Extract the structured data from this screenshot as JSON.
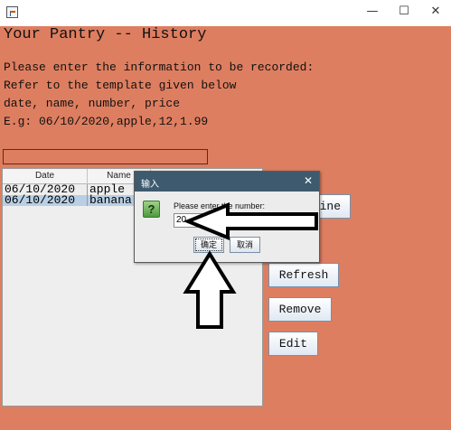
{
  "window": {
    "controls": {
      "minimize": "—",
      "maximize": "☐",
      "close": "✕"
    }
  },
  "main": {
    "heading": "Your Pantry -- History",
    "instructions": [
      "Please enter the information to be recorded:",
      "Refer to the template given below",
      "date, name, number, price",
      "E.g: 06/10/2020,apple,12,1.99"
    ],
    "input_value": ""
  },
  "table": {
    "columns": [
      "Date",
      "Name"
    ],
    "rows": [
      {
        "date": "06/10/2020",
        "name": "apple",
        "selected": false
      },
      {
        "date": "06/10/2020",
        "name": "banana",
        "selected": true
      }
    ]
  },
  "buttons": {
    "determine_partial": "ine",
    "refresh": "Refresh",
    "remove": "Remove",
    "edit": "Edit"
  },
  "dialog": {
    "title": "输入",
    "close": "✕",
    "icon": "?",
    "label": "Please enter the number:",
    "value": "20",
    "ok": "确定",
    "cancel": "取消"
  },
  "colors": {
    "panel": "#de7e60",
    "dialog_titlebar": "#3e5a6e",
    "selected_row": "#b8cfe5"
  }
}
